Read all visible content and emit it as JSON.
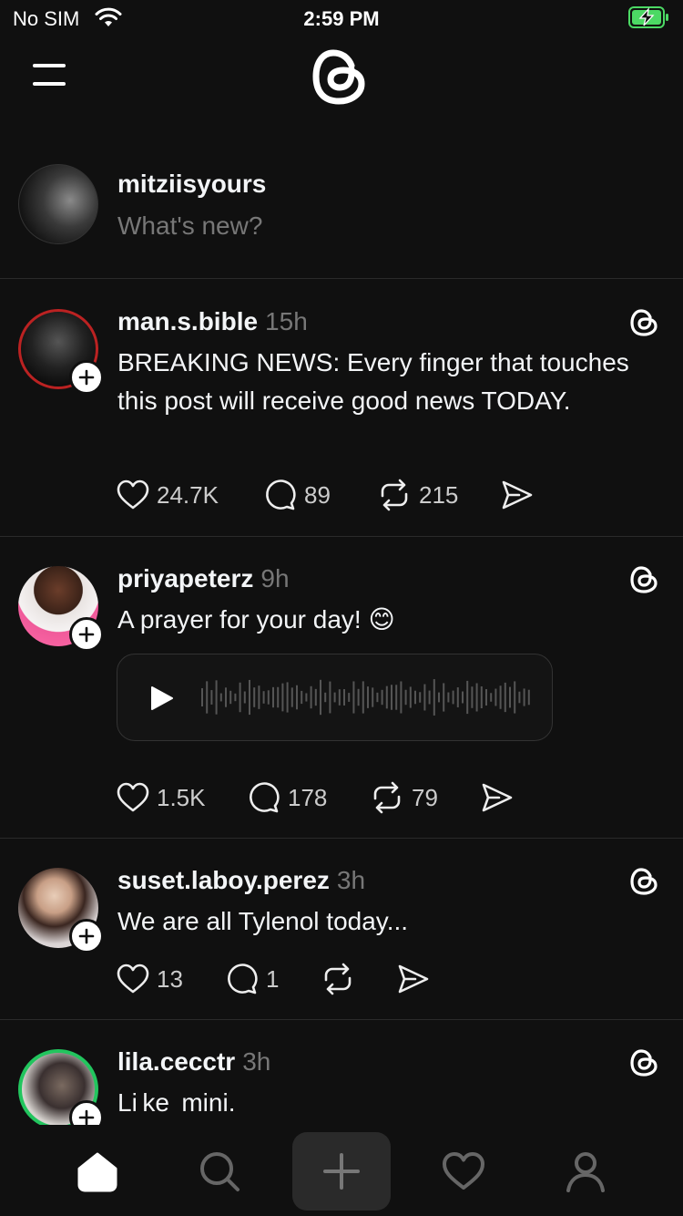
{
  "status_bar": {
    "carrier": "No SIM",
    "time": "2:59 PM",
    "battery_color": "#4cd964"
  },
  "header": {
    "menu_icon": "hamburger-menu-icon",
    "logo_icon": "threads-logo-icon"
  },
  "composer": {
    "username": "mitziisyours",
    "placeholder": "What's new?"
  },
  "posts": [
    {
      "username": "man.s.bible",
      "ago": "15h",
      "text": "BREAKING NEWS: Every finger that touches this post will receive good news TODAY.",
      "likes": "24.7K",
      "replies": "89",
      "reposts": "215"
    },
    {
      "username": "priyapeterz",
      "ago": "9h",
      "text": "A prayer for your day! 😊",
      "likes": "1.5K",
      "replies": "178",
      "reposts": "79",
      "has_audio": true
    },
    {
      "username": "suset.laboy.perez",
      "ago": "3h",
      "text": "We are all Tylenol today...",
      "likes": "13",
      "replies": "1",
      "reposts": ""
    },
    {
      "username": "lila.cecctr",
      "ago": "3h",
      "text": "Li ke  mini."
    }
  ],
  "nav": {
    "items": [
      "home-icon",
      "search-icon",
      "create-icon",
      "activity-heart-icon",
      "profile-icon"
    ]
  },
  "colors": {
    "background": "#101010",
    "text_primary": "#f3f5f7",
    "text_secondary": "#777777",
    "divider": "#2a2a2a"
  }
}
